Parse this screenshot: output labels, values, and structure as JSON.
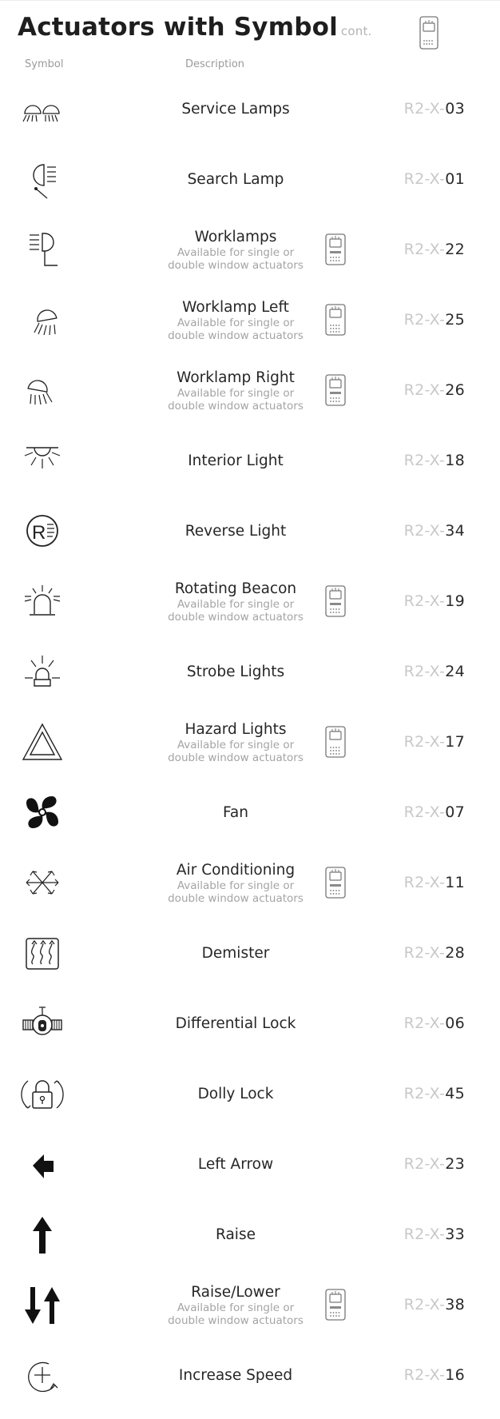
{
  "header": {
    "title": "Actuators with Symbol",
    "title_suffix": "cont.",
    "col_symbol": "Symbol",
    "col_description": "Description"
  },
  "colors": {
    "accent": "#2a2a2a",
    "muted": "#c8c8c8",
    "note": "#a4a4a4"
  },
  "items": [
    {
      "icon": "service-lamps-icon",
      "name": "Service Lamps",
      "note": "",
      "switch": "",
      "code_prefix": "R2-X-",
      "code_num": "03"
    },
    {
      "icon": "search-lamp-icon",
      "name": "Search Lamp",
      "note": "",
      "switch": "",
      "code_prefix": "R2-X-",
      "code_num": "01"
    },
    {
      "icon": "worklamps-icon",
      "name": "Worklamps",
      "note": "Available for single or double window actuators",
      "switch": "double",
      "code_prefix": "R2-X-",
      "code_num": "22"
    },
    {
      "icon": "worklamp-left-icon",
      "name": "Worklamp Left",
      "note": "Available for single or double window actuators",
      "switch": "single",
      "code_prefix": "R2-X-",
      "code_num": "25"
    },
    {
      "icon": "worklamp-right-icon",
      "name": "Worklamp Right",
      "note": "Available for single or double window actuators",
      "switch": "double",
      "code_prefix": "R2-X-",
      "code_num": "26"
    },
    {
      "icon": "interior-light-icon",
      "name": "Interior Light",
      "note": "",
      "switch": "",
      "code_prefix": "R2-X-",
      "code_num": "18"
    },
    {
      "icon": "reverse-light-icon",
      "name": "Reverse Light",
      "note": "",
      "switch": "",
      "code_prefix": "R2-X-",
      "code_num": "34"
    },
    {
      "icon": "rotating-beacon-icon",
      "name": "Rotating Beacon",
      "note": "Available for single or double window actuators",
      "switch": "double",
      "code_prefix": "R2-X-",
      "code_num": "19"
    },
    {
      "icon": "strobe-lights-icon",
      "name": "Strobe Lights",
      "note": "",
      "switch": "",
      "code_prefix": "R2-X-",
      "code_num": "24"
    },
    {
      "icon": "hazard-lights-icon",
      "name": "Hazard Lights",
      "note": "Available for single or double window actuators",
      "switch": "single",
      "code_prefix": "R2-X-",
      "code_num": "17"
    },
    {
      "icon": "fan-icon",
      "name": "Fan",
      "note": "",
      "switch": "",
      "code_prefix": "R2-X-",
      "code_num": "07"
    },
    {
      "icon": "air-conditioning-icon",
      "name": "Air Conditioning",
      "note": "Available for single or double window actuators",
      "switch": "double",
      "code_prefix": "R2-X-",
      "code_num": "11"
    },
    {
      "icon": "demister-icon",
      "name": "Demister",
      "note": "",
      "switch": "",
      "code_prefix": "R2-X-",
      "code_num": "28"
    },
    {
      "icon": "differential-lock-icon",
      "name": "Differential Lock",
      "note": "",
      "switch": "",
      "code_prefix": "R2-X-",
      "code_num": "06"
    },
    {
      "icon": "dolly-lock-icon",
      "name": "Dolly Lock",
      "note": "",
      "switch": "",
      "code_prefix": "R2-X-",
      "code_num": "45"
    },
    {
      "icon": "left-arrow-icon",
      "name": "Left Arrow",
      "note": "",
      "switch": "",
      "code_prefix": "R2-X-",
      "code_num": "23"
    },
    {
      "icon": "raise-icon",
      "name": "Raise",
      "note": "",
      "switch": "",
      "code_prefix": "R2-X-",
      "code_num": "33"
    },
    {
      "icon": "raise-lower-icon",
      "name": "Raise/Lower",
      "note": "Available for single or double window actuators",
      "switch": "double",
      "code_prefix": "R2-X-",
      "code_num": "38"
    },
    {
      "icon": "increase-speed-icon",
      "name": "Increase Speed",
      "note": "",
      "switch": "",
      "code_prefix": "R2-X-",
      "code_num": "16"
    }
  ]
}
